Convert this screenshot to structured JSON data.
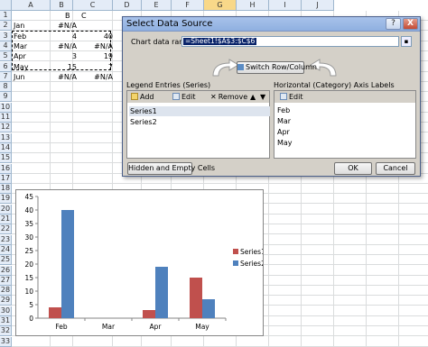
{
  "spreadsheet": {
    "columns": [
      "A",
      "B",
      "C",
      "D",
      "E",
      "F",
      "G",
      "H",
      "I",
      "J"
    ],
    "rows": [
      "1",
      "2",
      "3",
      "4",
      "5",
      "6",
      "7",
      "8",
      "9",
      "10",
      "11",
      "12",
      "13",
      "14",
      "15",
      "16",
      "17",
      "18",
      "19",
      "20",
      "21",
      "22",
      "23",
      "24",
      "25",
      "26",
      "27",
      "28",
      "29",
      "30",
      "31",
      "32",
      "33"
    ],
    "header_row": {
      "b": "B",
      "c": "C"
    },
    "data_rows": [
      {
        "a": "Jan",
        "b": "#N/A",
        "c": ""
      },
      {
        "a": "Feb",
        "b": "4",
        "c": "40"
      },
      {
        "a": "Mar",
        "b": "#N/A",
        "c": "#N/A"
      },
      {
        "a": "Apr",
        "b": "3",
        "c": "19"
      },
      {
        "a": "May",
        "b": "15",
        "c": "7"
      },
      {
        "a": "Jun",
        "b": "#N/A",
        "c": "#N/A"
      }
    ]
  },
  "dialog": {
    "title": "Select Data Source",
    "help_label": "?",
    "close_label": "X",
    "range_label": "Chart data range:",
    "range_value": "=Sheet1!$A$3:$C$6",
    "switch_label": "Switch Row/Column",
    "legend_header": "Legend Entries (Series)",
    "axis_header": "Horizontal (Category) Axis Labels",
    "add_label": "Add",
    "edit_label": "Edit",
    "remove_label": "Remove",
    "axis_edit_label": "Edit",
    "series": [
      "Series1",
      "Series2"
    ],
    "categories": [
      "Feb",
      "Mar",
      "Apr",
      "May"
    ],
    "hidden_cells_label": "Hidden and Empty Cells",
    "ok_label": "OK",
    "cancel_label": "Cancel"
  },
  "chart_data": {
    "type": "bar",
    "categories": [
      "Feb",
      "Mar",
      "Apr",
      "May"
    ],
    "series": [
      {
        "name": "Series1",
        "values": [
          4,
          null,
          3,
          15
        ],
        "color": "#c0504d"
      },
      {
        "name": "Series2",
        "values": [
          40,
          null,
          19,
          7
        ],
        "color": "#4f81bd"
      }
    ],
    "ylim": [
      0,
      45
    ],
    "yticks": [
      "0",
      "5",
      "10",
      "15",
      "20",
      "25",
      "30",
      "35",
      "40",
      "45"
    ],
    "legend_position": "right",
    "grid": false
  }
}
